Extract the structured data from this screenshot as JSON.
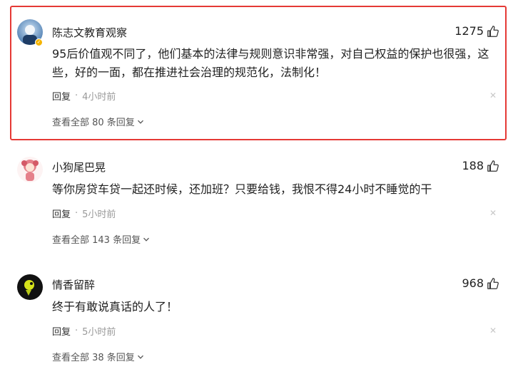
{
  "comments": [
    {
      "username": "陈志文教育观察",
      "likes": "1275",
      "content": "95后价值观不同了，他们基本的法律与规则意识非常强，对自己权益的保护也很强，这些，好的一面，都在推进社会治理的规范化，法制化！",
      "reply_label": "回复",
      "separator": "·",
      "time": "4小时前",
      "view_all": "查看全部 80 条回复",
      "verified": true,
      "highlighted": true
    },
    {
      "username": "小狗尾巴晃",
      "likes": "188",
      "content": "等你房贷车贷一起还时候，还加班？只要给钱，我恨不得24小时不睡觉的干",
      "reply_label": "回复",
      "separator": "·",
      "time": "5小时前",
      "view_all": "查看全部 143 条回复",
      "verified": false,
      "highlighted": false
    },
    {
      "username": "情香留醉",
      "likes": "968",
      "content": "终于有敢说真话的人了！",
      "reply_label": "回复",
      "separator": "·",
      "time": "5小时前",
      "view_all": "查看全部 38 条回复",
      "verified": false,
      "highlighted": false
    }
  ],
  "icons": {
    "like": "thumbs-up-icon",
    "close": "close-icon",
    "expand": "chevron-down-icon"
  },
  "colors": {
    "highlight_border": "#e53935",
    "text": "#222222",
    "muted": "#999999"
  }
}
